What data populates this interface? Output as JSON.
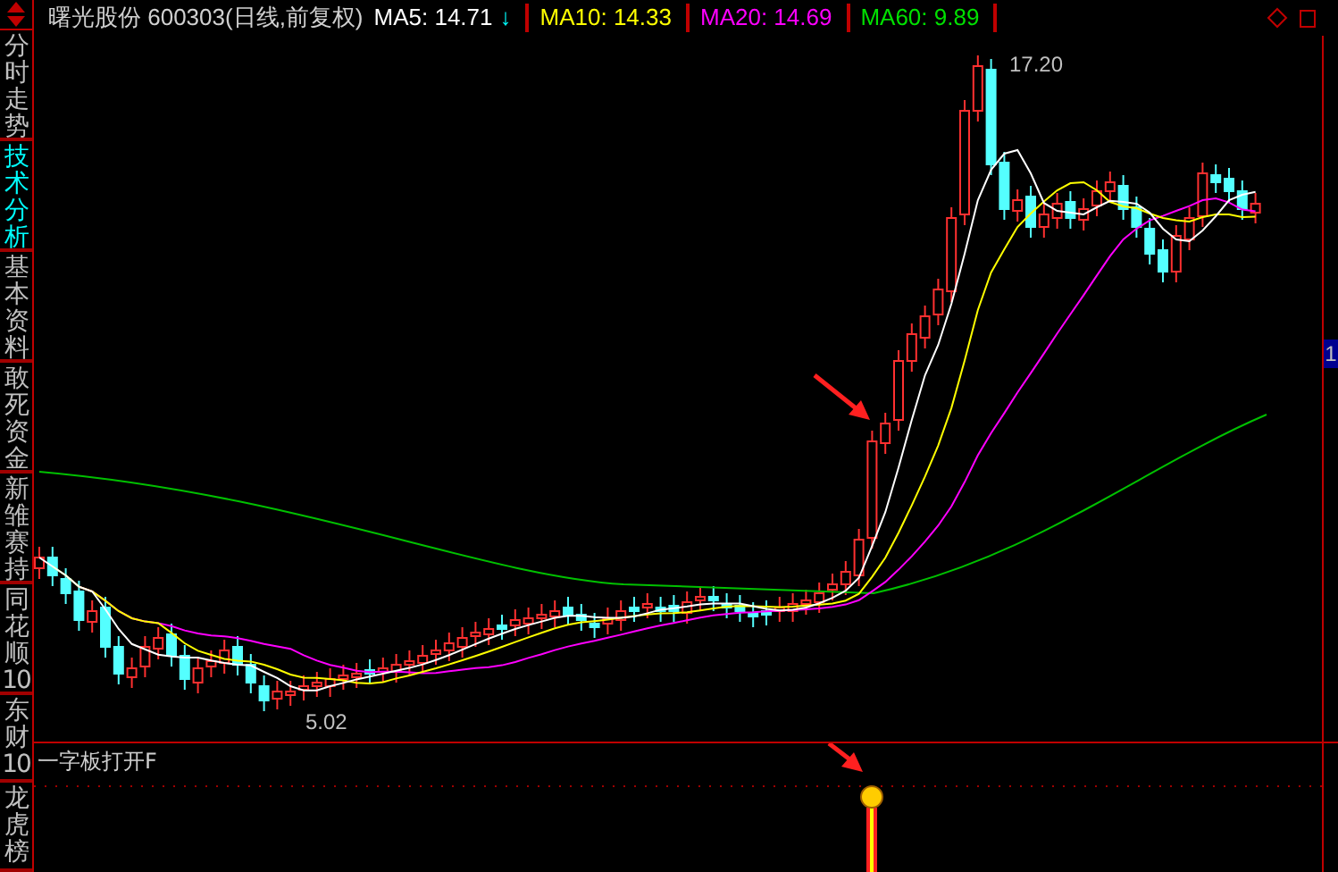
{
  "sidebar": {
    "tabs": [
      {
        "label": "分时走势",
        "selected": false
      },
      {
        "label": "技术分析",
        "selected": true
      },
      {
        "label": "基本资料",
        "selected": false
      },
      {
        "label": "敢死资金",
        "selected": false
      },
      {
        "label": "新雏赛持",
        "selected": false
      },
      {
        "label": "同花顺10",
        "selected": false
      },
      {
        "label": "东财10",
        "selected": false
      },
      {
        "label": "龙虎榜",
        "selected": false
      }
    ]
  },
  "header": {
    "title": "曙光股份 600303(日线,前复权)",
    "averages": [
      {
        "label": "MA5: 14.71",
        "arrow": "↓",
        "color": "#ffffff"
      },
      {
        "label": "MA10: 14.33",
        "color": "#ffff00"
      },
      {
        "label": "MA20: 14.69",
        "color": "#ff00ff"
      },
      {
        "label": "MA60: 9.89",
        "color": "#00e000"
      }
    ]
  },
  "chart": {
    "high_label": "17.20",
    "low_label": "5.02"
  },
  "axis": {
    "badge": "1"
  },
  "indicator": {
    "title": "一字板打开F"
  }
}
